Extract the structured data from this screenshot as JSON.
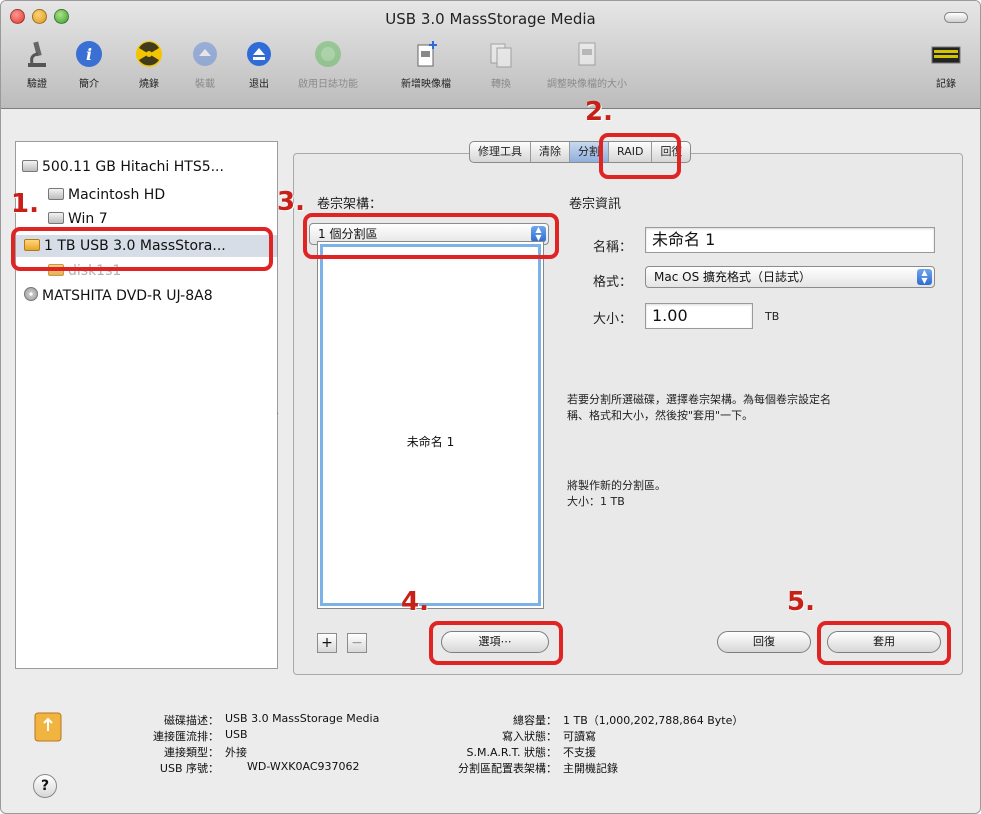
{
  "window": {
    "title": "USB 3.0 MassStorage Media"
  },
  "toolbar": {
    "items": [
      {
        "label": "驗證",
        "icon": "microscope-icon",
        "enabled": true
      },
      {
        "label": "簡介",
        "icon": "info-icon",
        "enabled": true
      },
      {
        "label": "燒錄",
        "icon": "burn-icon",
        "enabled": true
      },
      {
        "label": "裝載",
        "icon": "mount-icon",
        "enabled": false
      },
      {
        "label": "退出",
        "icon": "eject-icon",
        "enabled": true
      },
      {
        "label": "啟用日誌功能",
        "icon": "journal-icon",
        "enabled": false
      },
      {
        "label": "新增映像檔",
        "icon": "new-image-icon",
        "enabled": true
      },
      {
        "label": "轉換",
        "icon": "convert-icon",
        "enabled": false
      },
      {
        "label": "調整映像檔的大小",
        "icon": "resize-image-icon",
        "enabled": false
      }
    ],
    "log_label": "記錄",
    "log_icon": "log-icon"
  },
  "sidebar": {
    "items": [
      {
        "label": "500.11 GB Hitachi HTS5...",
        "icon": "hard-disk-icon"
      },
      {
        "label": "Macintosh HD",
        "icon": "volume-icon"
      },
      {
        "label": "Win 7",
        "icon": "volume-icon"
      },
      {
        "label": "1 TB USB 3.0 MassStora...",
        "icon": "usb-disk-icon",
        "selected": true
      },
      {
        "label": "disk1s1",
        "icon": "volume-icon",
        "dimmed": true
      },
      {
        "label": "MATSHITA DVD-R UJ-8A8",
        "icon": "dvd-drive-icon"
      }
    ]
  },
  "tabs": [
    {
      "label": "修理工具"
    },
    {
      "label": "清除"
    },
    {
      "label": "分割",
      "active": true
    },
    {
      "label": "RAID"
    },
    {
      "label": "回復"
    }
  ],
  "partition": {
    "layout_heading": "卷宗架構：",
    "layout_value": "1 個分割區",
    "volume_name": "未命名 1",
    "info_heading": "卷宗資訊",
    "name_label": "名稱：",
    "name_value": "未命名 1",
    "format_label": "格式：",
    "format_value": "Mac OS 擴充格式（日誌式）",
    "size_label": "大小：",
    "size_value": "1.00",
    "size_unit": "TB",
    "help_text_1": "若要分割所選磁碟，選擇卷宗架構。為每個卷宗設定名",
    "help_text_2": "稱、格式和大小，然後按\"套用\"一下。",
    "result_1": "將製作新的分割區。",
    "result_2": "大小：1 TB",
    "add_label": "+",
    "remove_label": "−",
    "options_label": "選項⋯",
    "revert_label": "回復",
    "apply_label": "套用"
  },
  "annotations": [
    "1.",
    "2.",
    "3.",
    "4.",
    "5."
  ],
  "disk_info": {
    "desc_key": "磁碟描述：",
    "desc_val": "USB 3.0 MassStorage Media",
    "bus_key": "連接匯流排：",
    "bus_val": "USB",
    "type_key": "連接類型：",
    "type_val": "外接",
    "serial_key": "USB 序號：",
    "serial_val": "WD-WXK0AC937062",
    "cap_key": "總容量：",
    "cap_val": "1 TB（1,000,202,788,864 Byte）",
    "write_key": "寫入狀態：",
    "write_val": "可讀寫",
    "smart_key": "S.M.A.R.T. 狀態：",
    "smart_val": "不支援",
    "map_key": "分割區配置表架構：",
    "map_val": "主開機記錄",
    "help_label": "?"
  },
  "colors": {
    "annotation": "#e02424",
    "annotation_number": "#c81f17",
    "selection": "#d6dde7",
    "partition_border": "#7bb2e8"
  }
}
